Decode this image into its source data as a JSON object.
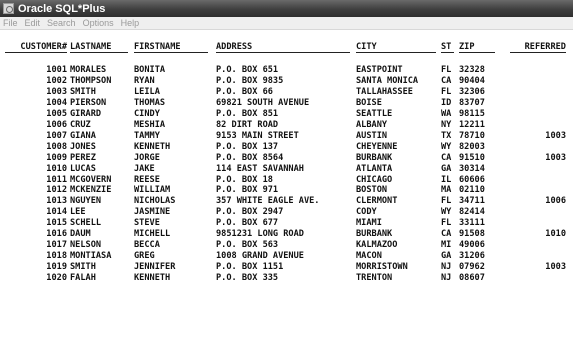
{
  "window": {
    "title": "Oracle SQL*Plus",
    "icon": "sqlplus-app-icon"
  },
  "menu": [
    "File",
    "Edit",
    "Search",
    "Options",
    "Help"
  ],
  "query": {
    "headers": [
      "CUSTOMER#",
      "LASTNAME",
      "FIRSTNAME",
      "ADDRESS",
      "CITY",
      "ST",
      "ZIP",
      "REFERRED"
    ],
    "rows": [
      [
        "1001",
        "MORALES",
        "BONITA",
        "P.O. BOX 651",
        "EASTPOINT",
        "FL",
        "32328",
        ""
      ],
      [
        "1002",
        "THOMPSON",
        "RYAN",
        "P.O. BOX 9835",
        "SANTA MONICA",
        "CA",
        "90404",
        ""
      ],
      [
        "1003",
        "SMITH",
        "LEILA",
        "P.O. BOX 66",
        "TALLAHASSEE",
        "FL",
        "32306",
        ""
      ],
      [
        "1004",
        "PIERSON",
        "THOMAS",
        "69821 SOUTH AVENUE",
        "BOISE",
        "ID",
        "83707",
        ""
      ],
      [
        "1005",
        "GIRARD",
        "CINDY",
        "P.O. BOX 851",
        "SEATTLE",
        "WA",
        "98115",
        ""
      ],
      [
        "1006",
        "CRUZ",
        "MESHIA",
        "82 DIRT ROAD",
        "ALBANY",
        "NY",
        "12211",
        ""
      ],
      [
        "1007",
        "GIANA",
        "TAMMY",
        "9153 MAIN STREET",
        "AUSTIN",
        "TX",
        "78710",
        "1003"
      ],
      [
        "1008",
        "JONES",
        "KENNETH",
        "P.O. BOX 137",
        "CHEYENNE",
        "WY",
        "82003",
        ""
      ],
      [
        "1009",
        "PEREZ",
        "JORGE",
        "P.O. BOX 8564",
        "BURBANK",
        "CA",
        "91510",
        "1003"
      ],
      [
        "1010",
        "LUCAS",
        "JAKE",
        "114 EAST SAVANNAH",
        "ATLANTA",
        "GA",
        "30314",
        ""
      ],
      [
        "1011",
        "MCGOVERN",
        "REESE",
        "P.O. BOX 18",
        "CHICAGO",
        "IL",
        "60606",
        ""
      ],
      [
        "1012",
        "MCKENZIE",
        "WILLIAM",
        "P.O. BOX 971",
        "BOSTON",
        "MA",
        "02110",
        ""
      ],
      [
        "1013",
        "NGUYEN",
        "NICHOLAS",
        "357 WHITE EAGLE AVE.",
        "CLERMONT",
        "FL",
        "34711",
        "1006"
      ],
      [
        "1014",
        "LEE",
        "JASMINE",
        "P.O. BOX 2947",
        "CODY",
        "WY",
        "82414",
        ""
      ],
      [
        "1015",
        "SCHELL",
        "STEVE",
        "P.O. BOX 677",
        "MIAMI",
        "FL",
        "33111",
        ""
      ],
      [
        "1016",
        "DAUM",
        "MICHELL",
        "9851231 LONG ROAD",
        "BURBANK",
        "CA",
        "91508",
        "1010"
      ],
      [
        "1017",
        "NELSON",
        "BECCA",
        "P.O. BOX 563",
        "KALMAZOO",
        "MI",
        "49006",
        ""
      ],
      [
        "1018",
        "MONTIASA",
        "GREG",
        "1008 GRAND AVENUE",
        "MACON",
        "GA",
        "31206",
        ""
      ],
      [
        "1019",
        "SMITH",
        "JENNIFER",
        "P.O. BOX 1151",
        "MORRISTOWN",
        "NJ",
        "07962",
        "1003"
      ],
      [
        "1020",
        "FALAH",
        "KENNETH",
        "P.O. BOX 335",
        "TRENTON",
        "NJ",
        "08607",
        ""
      ]
    ]
  }
}
